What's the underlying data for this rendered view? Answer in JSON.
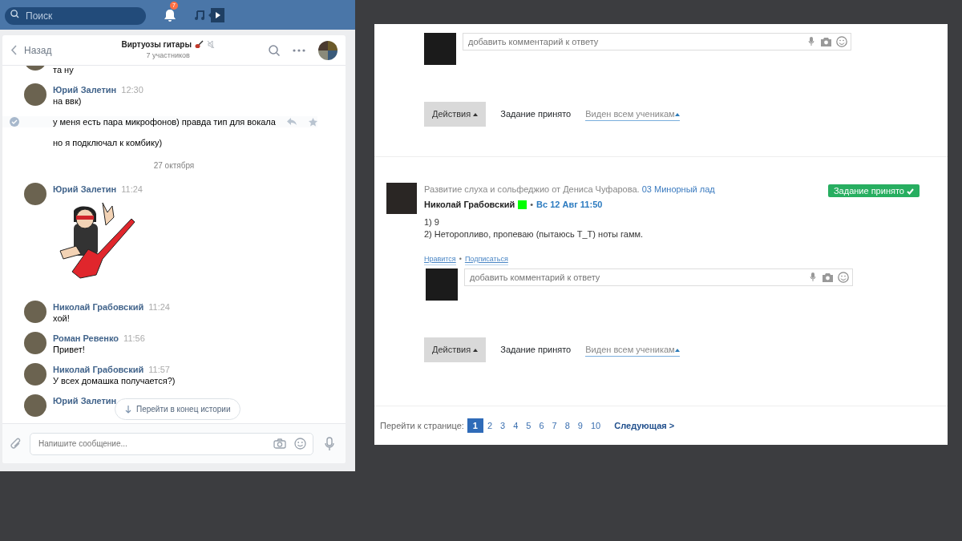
{
  "topbar": {
    "search": {
      "placeholder": "Поиск"
    },
    "notifications_badge": "7"
  },
  "chat": {
    "back": "Назад",
    "title": "Виртуозы гитары",
    "subtitle": "7 участников",
    "muted": true,
    "items": [
      {
        "kind": "message",
        "lines": [
          {
            "text": "та ну",
            "highlighted": false
          }
        ]
      },
      {
        "kind": "message",
        "author": "Юрий Залетин",
        "time": "12:30",
        "lines": [
          {
            "text": "на ввк)",
            "highlighted": false
          },
          {
            "text": "у меня есть пара микрофонов) правда тип для вокала",
            "highlighted": true
          },
          {
            "text": "но я подключал к комбику)",
            "highlighted": false
          }
        ]
      },
      {
        "kind": "date",
        "text": "27 октября"
      },
      {
        "kind": "message",
        "author": "Юрий Залетин",
        "time": "11:24",
        "sticker": true
      },
      {
        "kind": "message",
        "author": "Николай Грабовский",
        "time": "11:24",
        "lines": [
          {
            "text": "хой!",
            "highlighted": false
          }
        ]
      },
      {
        "kind": "message",
        "author": "Роман Ревенко",
        "time": "11:56",
        "lines": [
          {
            "text": "Привет!",
            "highlighted": false
          }
        ]
      },
      {
        "kind": "message",
        "author": "Николай Грабовский",
        "time": "11:57",
        "lines": [
          {
            "text": "У всех домашка получается?)",
            "highlighted": false
          }
        ]
      },
      {
        "kind": "message",
        "author": "Юрий Залетин"
      }
    ],
    "scroll_button": "Перейти в конец истории",
    "composer": {
      "placeholder": "Напишите сообщение..."
    }
  },
  "posts": [
    {
      "kind": "partial",
      "comment_placeholder": "добавить комментарий к ответу",
      "actions": {
        "menu": "Действия",
        "status": "Задание принято",
        "visibility": "Виден всем ученикам"
      }
    },
    {
      "kind": "full",
      "course": "Развитие слуха и сольфеджио от Дениса Чуфарова.",
      "lesson": "03 Минорный лад",
      "author": "Николай Грабовский",
      "color": "#00ff00",
      "separator": "•",
      "date": "Вс 12 Авг 11:50",
      "badge": "Задание принято",
      "lines": [
        "1) 9",
        "2) Неторопливо, пропеваю (пытаюсь T_T) ноты гамм."
      ],
      "links": [
        "Нравится",
        "•",
        "Подписаться"
      ],
      "comment_placeholder": "добавить комментарий к ответу",
      "actions": {
        "menu": "Действия",
        "status": "Задание принято",
        "visibility": "Виден всем ученикам"
      }
    }
  ],
  "pagination": {
    "label": "Перейти к странице:",
    "pages": [
      {
        "text": "1",
        "selected": true
      },
      {
        "text": "2",
        "selected": false
      },
      {
        "text": "3",
        "selected": false
      },
      {
        "text": "4",
        "selected": false
      },
      {
        "text": "5",
        "selected": false
      },
      {
        "text": "6",
        "selected": false
      },
      {
        "text": "7",
        "selected": false
      },
      {
        "text": "8",
        "selected": false
      },
      {
        "text": "9",
        "selected": false
      },
      {
        "text": "10",
        "selected": false
      }
    ],
    "next": "Следующая >"
  }
}
